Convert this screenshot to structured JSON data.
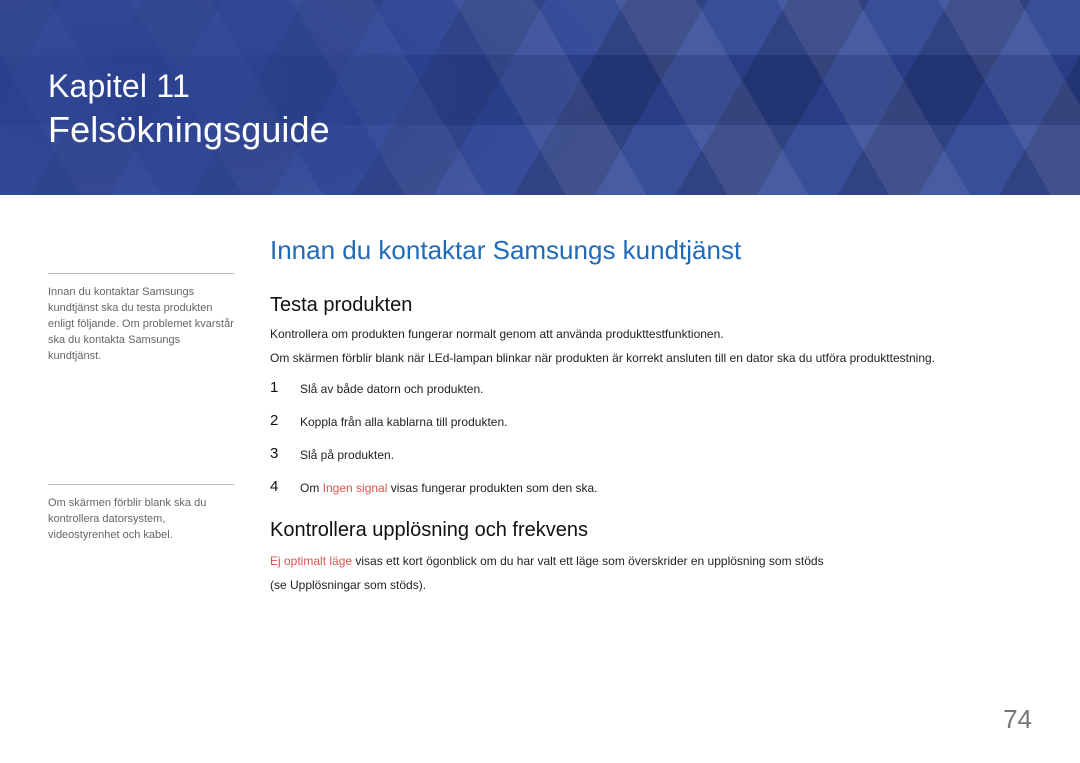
{
  "header": {
    "chapter_number_line": "Kapitel 11",
    "chapter_title": "Felsökningsguide"
  },
  "sidebar": {
    "note1": "Innan du kontaktar Samsungs kundtjänst ska du testa produkten enligt följande. Om problemet kvarstår ska du kontakta Samsungs kundtjänst.",
    "note2": "Om skärmen förblir blank ska du kontrollera datorsystem, videostyrenhet och kabel."
  },
  "main": {
    "section_title": "Innan du kontaktar Samsungs kundtjänst",
    "subsection1": {
      "title": "Testa produkten",
      "para1": "Kontrollera om produkten fungerar normalt genom att använda produkttestfunktionen.",
      "para2": "Om skärmen förblir blank när LEd-lampan blinkar när produkten är korrekt ansluten till en dator ska du utföra produkttestning.",
      "steps": [
        {
          "num": "1",
          "text": "Slå av både datorn och produkten."
        },
        {
          "num": "2",
          "text": "Koppla från alla kablarna till produkten."
        },
        {
          "num": "3",
          "text": "Slå på produkten."
        },
        {
          "num": "4",
          "pre": "Om ",
          "kw": "Ingen signal",
          "post": " visas fungerar produkten som den ska."
        }
      ]
    },
    "subsection2": {
      "title": "Kontrollera upplösning och frekvens",
      "line1_kw": "Ej optimalt läge",
      "line1_rest": " visas ett kort ögonblick om du har valt ett läge som överskrider en upplösning som stöds",
      "line2": "(se Upplösningar som stöds)."
    }
  },
  "page_number": "74"
}
